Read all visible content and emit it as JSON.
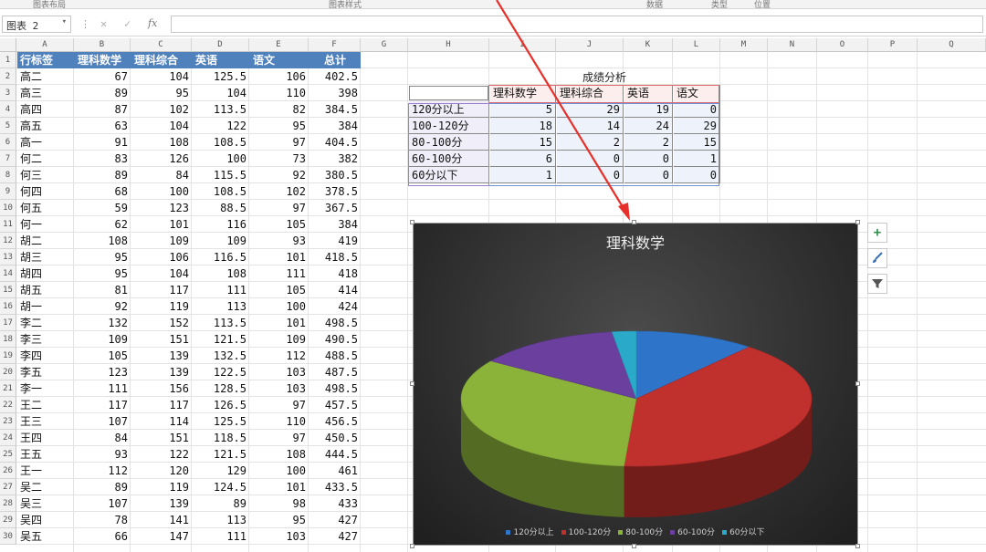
{
  "ribbon": {
    "groups": [
      "图表布局",
      "图表样式",
      "数据",
      "类型",
      "位置"
    ]
  },
  "formula_bar": {
    "name_box": "图表 2",
    "cancel_icon": "x-icon",
    "enter_icon": "check-icon",
    "fx_label": "fx",
    "formula": ""
  },
  "columns": [
    "A",
    "B",
    "C",
    "D",
    "E",
    "F",
    "G",
    "H",
    "I",
    "J",
    "K",
    "L",
    "M",
    "N",
    "O",
    "P",
    "Q"
  ],
  "rows": [
    "1",
    "2",
    "3",
    "4",
    "5",
    "6",
    "7",
    "8",
    "9",
    "10",
    "11",
    "12",
    "13",
    "14",
    "15",
    "16",
    "17",
    "18",
    "19",
    "20",
    "21",
    "22",
    "23",
    "24",
    "25",
    "26",
    "27",
    "28",
    "29",
    "30"
  ],
  "table_headers": [
    "行标签",
    "理科数学",
    "理科综合",
    "英语",
    "语文",
    "总计"
  ],
  "table_rows": [
    [
      "高二",
      "67",
      "104",
      "125.5",
      "106",
      "402.5"
    ],
    [
      "高三",
      "89",
      "95",
      "104",
      "110",
      "398"
    ],
    [
      "高四",
      "87",
      "102",
      "113.5",
      "82",
      "384.5"
    ],
    [
      "高五",
      "63",
      "104",
      "122",
      "95",
      "384"
    ],
    [
      "高一",
      "91",
      "108",
      "108.5",
      "97",
      "404.5"
    ],
    [
      "何二",
      "83",
      "126",
      "100",
      "73",
      "382"
    ],
    [
      "何三",
      "89",
      "84",
      "115.5",
      "92",
      "380.5"
    ],
    [
      "何四",
      "68",
      "100",
      "108.5",
      "102",
      "378.5"
    ],
    [
      "何五",
      "59",
      "123",
      "88.5",
      "97",
      "367.5"
    ],
    [
      "何一",
      "62",
      "101",
      "116",
      "105",
      "384"
    ],
    [
      "胡二",
      "108",
      "109",
      "109",
      "93",
      "419"
    ],
    [
      "胡三",
      "95",
      "106",
      "116.5",
      "101",
      "418.5"
    ],
    [
      "胡四",
      "95",
      "104",
      "108",
      "111",
      "418"
    ],
    [
      "胡五",
      "81",
      "117",
      "111",
      "105",
      "414"
    ],
    [
      "胡一",
      "92",
      "119",
      "113",
      "100",
      "424"
    ],
    [
      "李二",
      "132",
      "152",
      "113.5",
      "101",
      "498.5"
    ],
    [
      "李三",
      "109",
      "151",
      "121.5",
      "109",
      "490.5"
    ],
    [
      "李四",
      "105",
      "139",
      "132.5",
      "112",
      "488.5"
    ],
    [
      "李五",
      "123",
      "139",
      "122.5",
      "103",
      "487.5"
    ],
    [
      "李一",
      "111",
      "156",
      "128.5",
      "103",
      "498.5"
    ],
    [
      "王二",
      "117",
      "117",
      "126.5",
      "97",
      "457.5"
    ],
    [
      "王三",
      "107",
      "114",
      "125.5",
      "110",
      "456.5"
    ],
    [
      "王四",
      "84",
      "151",
      "118.5",
      "97",
      "450.5"
    ],
    [
      "王五",
      "93",
      "122",
      "121.5",
      "108",
      "444.5"
    ],
    [
      "王一",
      "112",
      "120",
      "129",
      "100",
      "461"
    ],
    [
      "吴二",
      "89",
      "119",
      "124.5",
      "101",
      "433.5"
    ],
    [
      "吴三",
      "107",
      "139",
      "89",
      "98",
      "433"
    ],
    [
      "吴四",
      "78",
      "141",
      "113",
      "95",
      "427"
    ],
    [
      "吴五",
      "66",
      "147",
      "111",
      "103",
      "427"
    ]
  ],
  "analysis": {
    "title": "成绩分析",
    "headers": [
      "理科数学",
      "理科综合",
      "英语",
      "语文"
    ],
    "rows": [
      {
        "label": "120分以上",
        "values": [
          "5",
          "29",
          "19",
          "0"
        ]
      },
      {
        "label": "100-120分",
        "values": [
          "18",
          "14",
          "24",
          "29"
        ]
      },
      {
        "label": "80-100分",
        "values": [
          "15",
          "2",
          "2",
          "15"
        ]
      },
      {
        "label": "60-100分",
        "values": [
          "6",
          "0",
          "0",
          "1"
        ]
      },
      {
        "label": "60分以下",
        "values": [
          "1",
          "0",
          "0",
          "0"
        ]
      }
    ]
  },
  "side_buttons": [
    "plus-icon",
    "brush-icon",
    "filter-icon"
  ],
  "colors": {
    "header_fill": "#4f81bd",
    "slice_120": "#2e75c9",
    "slice_100_120": "#c0302d",
    "slice_80_100": "#8bb33a",
    "slice_60_100": "#6a3f9e",
    "slice_60_below": "#2aa9c9",
    "arrow": "#e8302a"
  },
  "chart_data": {
    "type": "pie",
    "title": "理科数学",
    "categories": [
      "120分以上",
      "100-120分",
      "80-100分",
      "60-100分",
      "60分以下"
    ],
    "values": [
      5,
      18,
      15,
      6,
      1
    ],
    "legend": "bottom",
    "style": "3d"
  }
}
